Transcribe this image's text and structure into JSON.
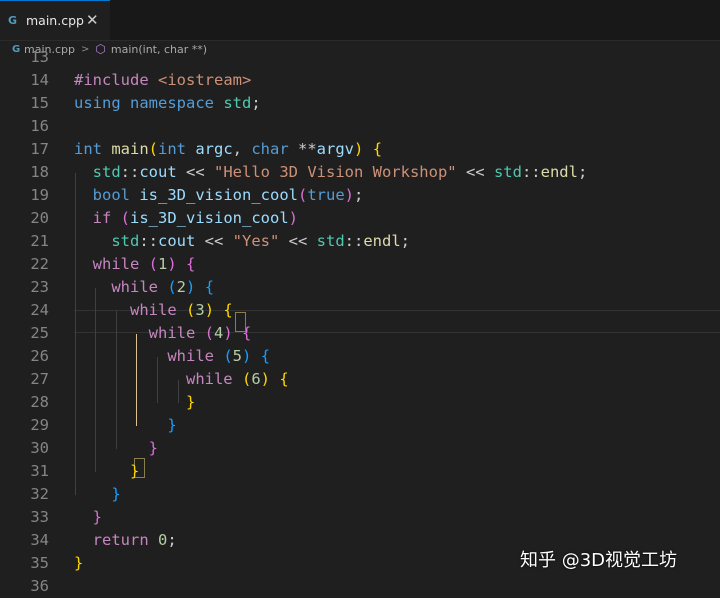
{
  "tab": {
    "icon": "C++ file icon",
    "label": "main.cpp"
  },
  "breadcrumb": {
    "file": "main.cpp",
    "symbol": "main(int, char **)"
  },
  "editor": {
    "lines": [
      {
        "n": "13",
        "tokens": []
      },
      {
        "n": "14",
        "tokens": [
          {
            "t": "#include ",
            "c": "ctl"
          },
          {
            "t": "<iostream>",
            "c": "inc"
          }
        ]
      },
      {
        "n": "15",
        "tokens": [
          {
            "t": "using ",
            "c": "kw"
          },
          {
            "t": "namespace ",
            "c": "kw"
          },
          {
            "t": "std",
            "c": "ty"
          },
          {
            "t": ";",
            "c": ""
          }
        ]
      },
      {
        "n": "16",
        "tokens": []
      },
      {
        "n": "17",
        "tokens": [
          {
            "t": "int ",
            "c": "kw"
          },
          {
            "t": "main",
            "c": "fn"
          },
          {
            "t": "(",
            "c": "b1"
          },
          {
            "t": "int ",
            "c": "kw"
          },
          {
            "t": "argc",
            "c": "var"
          },
          {
            "t": ", ",
            "c": ""
          },
          {
            "t": "char ",
            "c": "kw"
          },
          {
            "t": "**",
            "c": ""
          },
          {
            "t": "argv",
            "c": "var"
          },
          {
            "t": ")",
            "c": "b1"
          },
          {
            "t": " ",
            "c": ""
          },
          {
            "t": "{",
            "c": "b1"
          }
        ]
      },
      {
        "n": "18",
        "tokens": [
          {
            "t": "  ",
            "c": ""
          },
          {
            "t": "std",
            "c": "ty"
          },
          {
            "t": "::",
            "c": ""
          },
          {
            "t": "cout",
            "c": "var"
          },
          {
            "t": " << ",
            "c": ""
          },
          {
            "t": "\"Hello 3D Vision Workshop\"",
            "c": "str"
          },
          {
            "t": " << ",
            "c": ""
          },
          {
            "t": "std",
            "c": "ty"
          },
          {
            "t": "::",
            "c": ""
          },
          {
            "t": "endl",
            "c": "fn"
          },
          {
            "t": ";",
            "c": ""
          }
        ]
      },
      {
        "n": "19",
        "tokens": [
          {
            "t": "  ",
            "c": ""
          },
          {
            "t": "bool ",
            "c": "kw"
          },
          {
            "t": "is_3D_vision_cool",
            "c": "var"
          },
          {
            "t": "(",
            "c": "b2"
          },
          {
            "t": "true",
            "c": "kw"
          },
          {
            "t": ")",
            "c": "b2"
          },
          {
            "t": ";",
            "c": ""
          }
        ]
      },
      {
        "n": "20",
        "tokens": [
          {
            "t": "  ",
            "c": ""
          },
          {
            "t": "if ",
            "c": "ctl"
          },
          {
            "t": "(",
            "c": "b2"
          },
          {
            "t": "is_3D_vision_cool",
            "c": "var"
          },
          {
            "t": ")",
            "c": "b2"
          }
        ]
      },
      {
        "n": "21",
        "tokens": [
          {
            "t": "    ",
            "c": ""
          },
          {
            "t": "std",
            "c": "ty"
          },
          {
            "t": "::",
            "c": ""
          },
          {
            "t": "cout",
            "c": "var"
          },
          {
            "t": " << ",
            "c": ""
          },
          {
            "t": "\"Yes\"",
            "c": "str"
          },
          {
            "t": " << ",
            "c": ""
          },
          {
            "t": "std",
            "c": "ty"
          },
          {
            "t": "::",
            "c": ""
          },
          {
            "t": "endl",
            "c": "fn"
          },
          {
            "t": ";",
            "c": ""
          }
        ]
      },
      {
        "n": "22",
        "tokens": [
          {
            "t": "  ",
            "c": ""
          },
          {
            "t": "while ",
            "c": "ctl"
          },
          {
            "t": "(",
            "c": "b2"
          },
          {
            "t": "1",
            "c": "num"
          },
          {
            "t": ")",
            "c": "b2"
          },
          {
            "t": " ",
            "c": ""
          },
          {
            "t": "{",
            "c": "b2"
          }
        ]
      },
      {
        "n": "23",
        "tokens": [
          {
            "t": "    ",
            "c": ""
          },
          {
            "t": "while ",
            "c": "ctl"
          },
          {
            "t": "(",
            "c": "b3"
          },
          {
            "t": "2",
            "c": "num"
          },
          {
            "t": ")",
            "c": "b3"
          },
          {
            "t": " ",
            "c": ""
          },
          {
            "t": "{",
            "c": "b3"
          }
        ]
      },
      {
        "n": "24",
        "tokens": [
          {
            "t": "      ",
            "c": ""
          },
          {
            "t": "while ",
            "c": "ctl"
          },
          {
            "t": "(",
            "c": "b1"
          },
          {
            "t": "3",
            "c": "num"
          },
          {
            "t": ")",
            "c": "b1"
          },
          {
            "t": " ",
            "c": ""
          },
          {
            "t": "{",
            "c": "b1"
          }
        ]
      },
      {
        "n": "25",
        "tokens": [
          {
            "t": "        ",
            "c": ""
          },
          {
            "t": "while ",
            "c": "ctl"
          },
          {
            "t": "(",
            "c": "b2"
          },
          {
            "t": "4",
            "c": "num"
          },
          {
            "t": ")",
            "c": "b2"
          },
          {
            "t": " ",
            "c": ""
          },
          {
            "t": "{",
            "c": "b2"
          }
        ]
      },
      {
        "n": "26",
        "tokens": [
          {
            "t": "          ",
            "c": ""
          },
          {
            "t": "while ",
            "c": "ctl"
          },
          {
            "t": "(",
            "c": "b3"
          },
          {
            "t": "5",
            "c": "num"
          },
          {
            "t": ")",
            "c": "b3"
          },
          {
            "t": " ",
            "c": ""
          },
          {
            "t": "{",
            "c": "b3"
          }
        ]
      },
      {
        "n": "27",
        "tokens": [
          {
            "t": "            ",
            "c": ""
          },
          {
            "t": "while ",
            "c": "ctl"
          },
          {
            "t": "(",
            "c": "b1"
          },
          {
            "t": "6",
            "c": "num"
          },
          {
            "t": ")",
            "c": "b1"
          },
          {
            "t": " ",
            "c": ""
          },
          {
            "t": "{",
            "c": "b1"
          }
        ]
      },
      {
        "n": "28",
        "tokens": [
          {
            "t": "            ",
            "c": ""
          },
          {
            "t": "}",
            "c": "b1"
          }
        ]
      },
      {
        "n": "29",
        "tokens": [
          {
            "t": "          ",
            "c": ""
          },
          {
            "t": "}",
            "c": "b3"
          }
        ]
      },
      {
        "n": "30",
        "tokens": [
          {
            "t": "        ",
            "c": ""
          },
          {
            "t": "}",
            "c": "b2"
          }
        ]
      },
      {
        "n": "31",
        "tokens": [
          {
            "t": "      ",
            "c": ""
          },
          {
            "t": "}",
            "c": "b1"
          }
        ]
      },
      {
        "n": "32",
        "tokens": [
          {
            "t": "    ",
            "c": ""
          },
          {
            "t": "}",
            "c": "b3"
          }
        ]
      },
      {
        "n": "33",
        "tokens": [
          {
            "t": "  ",
            "c": ""
          },
          {
            "t": "}",
            "c": "b2"
          }
        ]
      },
      {
        "n": "34",
        "tokens": [
          {
            "t": "  ",
            "c": ""
          },
          {
            "t": "return ",
            "c": "ctl"
          },
          {
            "t": "0",
            "c": "num"
          },
          {
            "t": ";",
            "c": ""
          }
        ]
      },
      {
        "n": "35",
        "tokens": [
          {
            "t": "}",
            "c": "b1"
          }
        ]
      },
      {
        "n": "36",
        "tokens": []
      }
    ]
  },
  "watermark": "知乎 @3D视觉工坊"
}
